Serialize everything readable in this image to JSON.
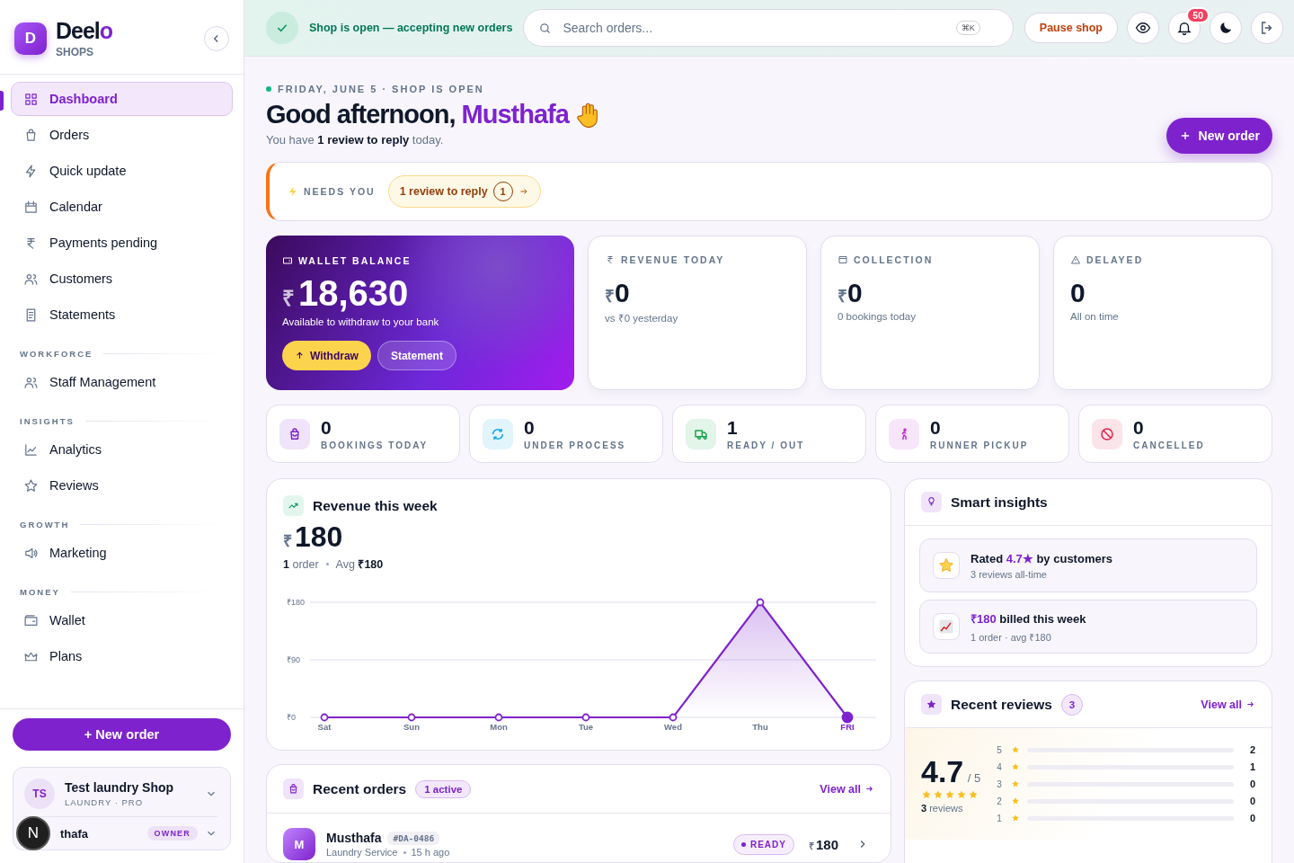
{
  "brand": {
    "logo_letter": "D",
    "name": "Deel",
    "name_accent": "o",
    "subtitle": "SHOPS"
  },
  "sidebar": {
    "groups": [
      {
        "items": [
          {
            "label": "Dashboard",
            "selected": true
          },
          {
            "label": "Orders",
            "selected": false
          },
          {
            "label": "Quick update",
            "selected": false
          },
          {
            "label": "Calendar",
            "selected": false
          },
          {
            "label": "Payments pending",
            "selected": false
          },
          {
            "label": "Customers",
            "selected": false
          },
          {
            "label": "Statements",
            "selected": false
          }
        ]
      },
      {
        "title": "WORKFORCE",
        "items": [
          {
            "label": "Staff Management",
            "selected": false
          }
        ]
      },
      {
        "title": "INSIGHTS",
        "items": [
          {
            "label": "Analytics",
            "selected": false
          },
          {
            "label": "Reviews",
            "selected": false
          }
        ]
      },
      {
        "title": "GROWTH",
        "items": [
          {
            "label": "Marketing",
            "selected": false
          }
        ]
      },
      {
        "title": "MONEY",
        "items": [
          {
            "label": "Wallet",
            "selected": false
          },
          {
            "label": "Plans",
            "selected": false
          }
        ]
      }
    ],
    "new_order": "+ New order",
    "shop": {
      "initials": "TS",
      "name": "Test laundry Shop",
      "meta": "LAUNDRY · PRO"
    },
    "user": {
      "name": "thafa",
      "role": "OWNER"
    },
    "dev_badge": "N"
  },
  "topbar": {
    "status": "Shop is open — accepting new orders",
    "search": {
      "placeholder": "Search orders...",
      "shortcut": "⌘K"
    },
    "pause_button": "Pause shop",
    "notifications": "50"
  },
  "header": {
    "date_line": "FRIDAY, JUNE 5 · SHOP IS OPEN",
    "greeting": "Good afternoon,",
    "name": "Musthafa",
    "subtitle": "You have **1 review to reply** today.",
    "new_order": "New order"
  },
  "needs_you": {
    "label": "NEEDS YOU",
    "chip": {
      "label": "1 review to reply",
      "count": "1"
    }
  },
  "wallet": {
    "label": "WALLET BALANCE",
    "currency": "₹",
    "amount": "18,630",
    "note": "Available to withdraw to your bank",
    "withdraw": "Withdraw",
    "statement": "Statement"
  },
  "stats": [
    {
      "label": "REVENUE TODAY",
      "currency": "₹",
      "value": "0",
      "note": "vs ₹0 yesterday"
    },
    {
      "label": "COLLECTION",
      "currency": "₹",
      "value": "0",
      "note": "0 bookings today"
    },
    {
      "label": "DELAYED",
      "value": "0",
      "note": "All on time"
    }
  ],
  "counters": [
    {
      "value": "0",
      "label": "BOOKINGS TODAY",
      "color": "#7e22ce"
    },
    {
      "value": "0",
      "label": "UNDER PROCESS",
      "color": "#0ea5e9"
    },
    {
      "value": "1",
      "label": "READY / OUT",
      "color": "#16a34a"
    },
    {
      "value": "0",
      "label": "RUNNER PICKUP",
      "color": "#c026d3"
    },
    {
      "value": "0",
      "label": "CANCELLED",
      "color": "#e11d48"
    }
  ],
  "revenue": {
    "title": "Revenue this week",
    "currency": "₹",
    "total": "180",
    "orders_count": "1",
    "orders_label": "order",
    "avg_label": "Avg",
    "avg_value": "₹180",
    "last_is_today": true,
    "chart_data": {
      "type": "area",
      "categories": [
        "Sat",
        "Sun",
        "Mon",
        "Tue",
        "Wed",
        "Thu",
        "FRI"
      ],
      "series": [
        {
          "color": "#7e22ce",
          "values": [
            0,
            0,
            0,
            0,
            0,
            180,
            0
          ]
        }
      ],
      "ylim": [
        0,
        180
      ],
      "yticks": [
        {
          "value": 0,
          "label": "₹0"
        },
        {
          "value": 90,
          "label": "₹90"
        },
        {
          "value": 180,
          "label": "₹180"
        }
      ]
    }
  },
  "recent_orders": {
    "title": "Recent orders",
    "badge": "1 active",
    "view_all": "View all",
    "rows": [
      {
        "initial": "M",
        "name": "Musthafa",
        "code": "#DA-0486",
        "service": "Laundry Service",
        "time": "15 h ago",
        "status": "READY",
        "currency": "₹",
        "amount": "180"
      }
    ]
  },
  "insights": {
    "title": "Smart insights",
    "items": [
      {
        "prefix": "Rated ",
        "highlight": "4.7★",
        "suffix": " by customers",
        "note": "3 reviews all-time"
      },
      {
        "highlight": "₹180",
        "suffix": " billed this week",
        "note": "1 order · avg ₹180"
      }
    ]
  },
  "reviews": {
    "title": "Recent reviews",
    "count": "3",
    "view_all": "View all",
    "score": "4.7",
    "out_of": "/ 5",
    "stars": 5,
    "total_count": "3",
    "total_label": "reviews",
    "distribution": [
      {
        "rating": "5",
        "count": "2",
        "level": 0
      },
      {
        "rating": "4",
        "count": "1",
        "level": 0
      },
      {
        "rating": "3",
        "count": "0",
        "level": 0
      },
      {
        "rating": "2",
        "count": "0",
        "level": 0
      },
      {
        "rating": "1",
        "count": "0",
        "level": 0
      }
    ]
  }
}
